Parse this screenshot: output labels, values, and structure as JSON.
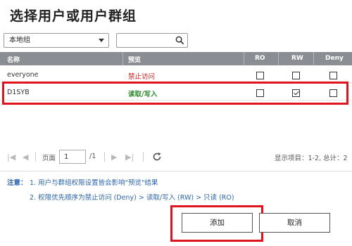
{
  "dialog": {
    "title": "选择用户或用户群组"
  },
  "filter": {
    "scope_value": "本地组",
    "search_placeholder": ""
  },
  "table": {
    "headers": {
      "name": "名称",
      "preview": "预览",
      "ro": "RO",
      "rw": "RW",
      "deny": "Deny"
    },
    "rows": [
      {
        "name": "everyone",
        "preview": "禁止访问",
        "ro": false,
        "rw": false,
        "deny": false
      },
      {
        "name": "D1SYB",
        "preview": "读取/写入",
        "ro": false,
        "rw": true,
        "deny": false
      }
    ]
  },
  "pager": {
    "page_label": "页面",
    "page_value": "1",
    "total_pages": "/1",
    "display_info": "显示项目：1-2, 总计：2"
  },
  "notes": {
    "label": "注意：",
    "note1": "1. 用户与群组权限设置皆会影响\"预览\"结果",
    "note2": "2. 权限优先顺序为禁止访问 (Deny) > 读取/写入 (RW) > 只读 (RO)"
  },
  "buttons": {
    "add": "添加",
    "cancel": "取消"
  },
  "colors": {
    "header_bg": "#8a8d92",
    "highlight": "#e0141c",
    "note_text": "#2a65ad",
    "deny_text": "#cc1d1d",
    "rw_text": "#2f8a2f"
  }
}
